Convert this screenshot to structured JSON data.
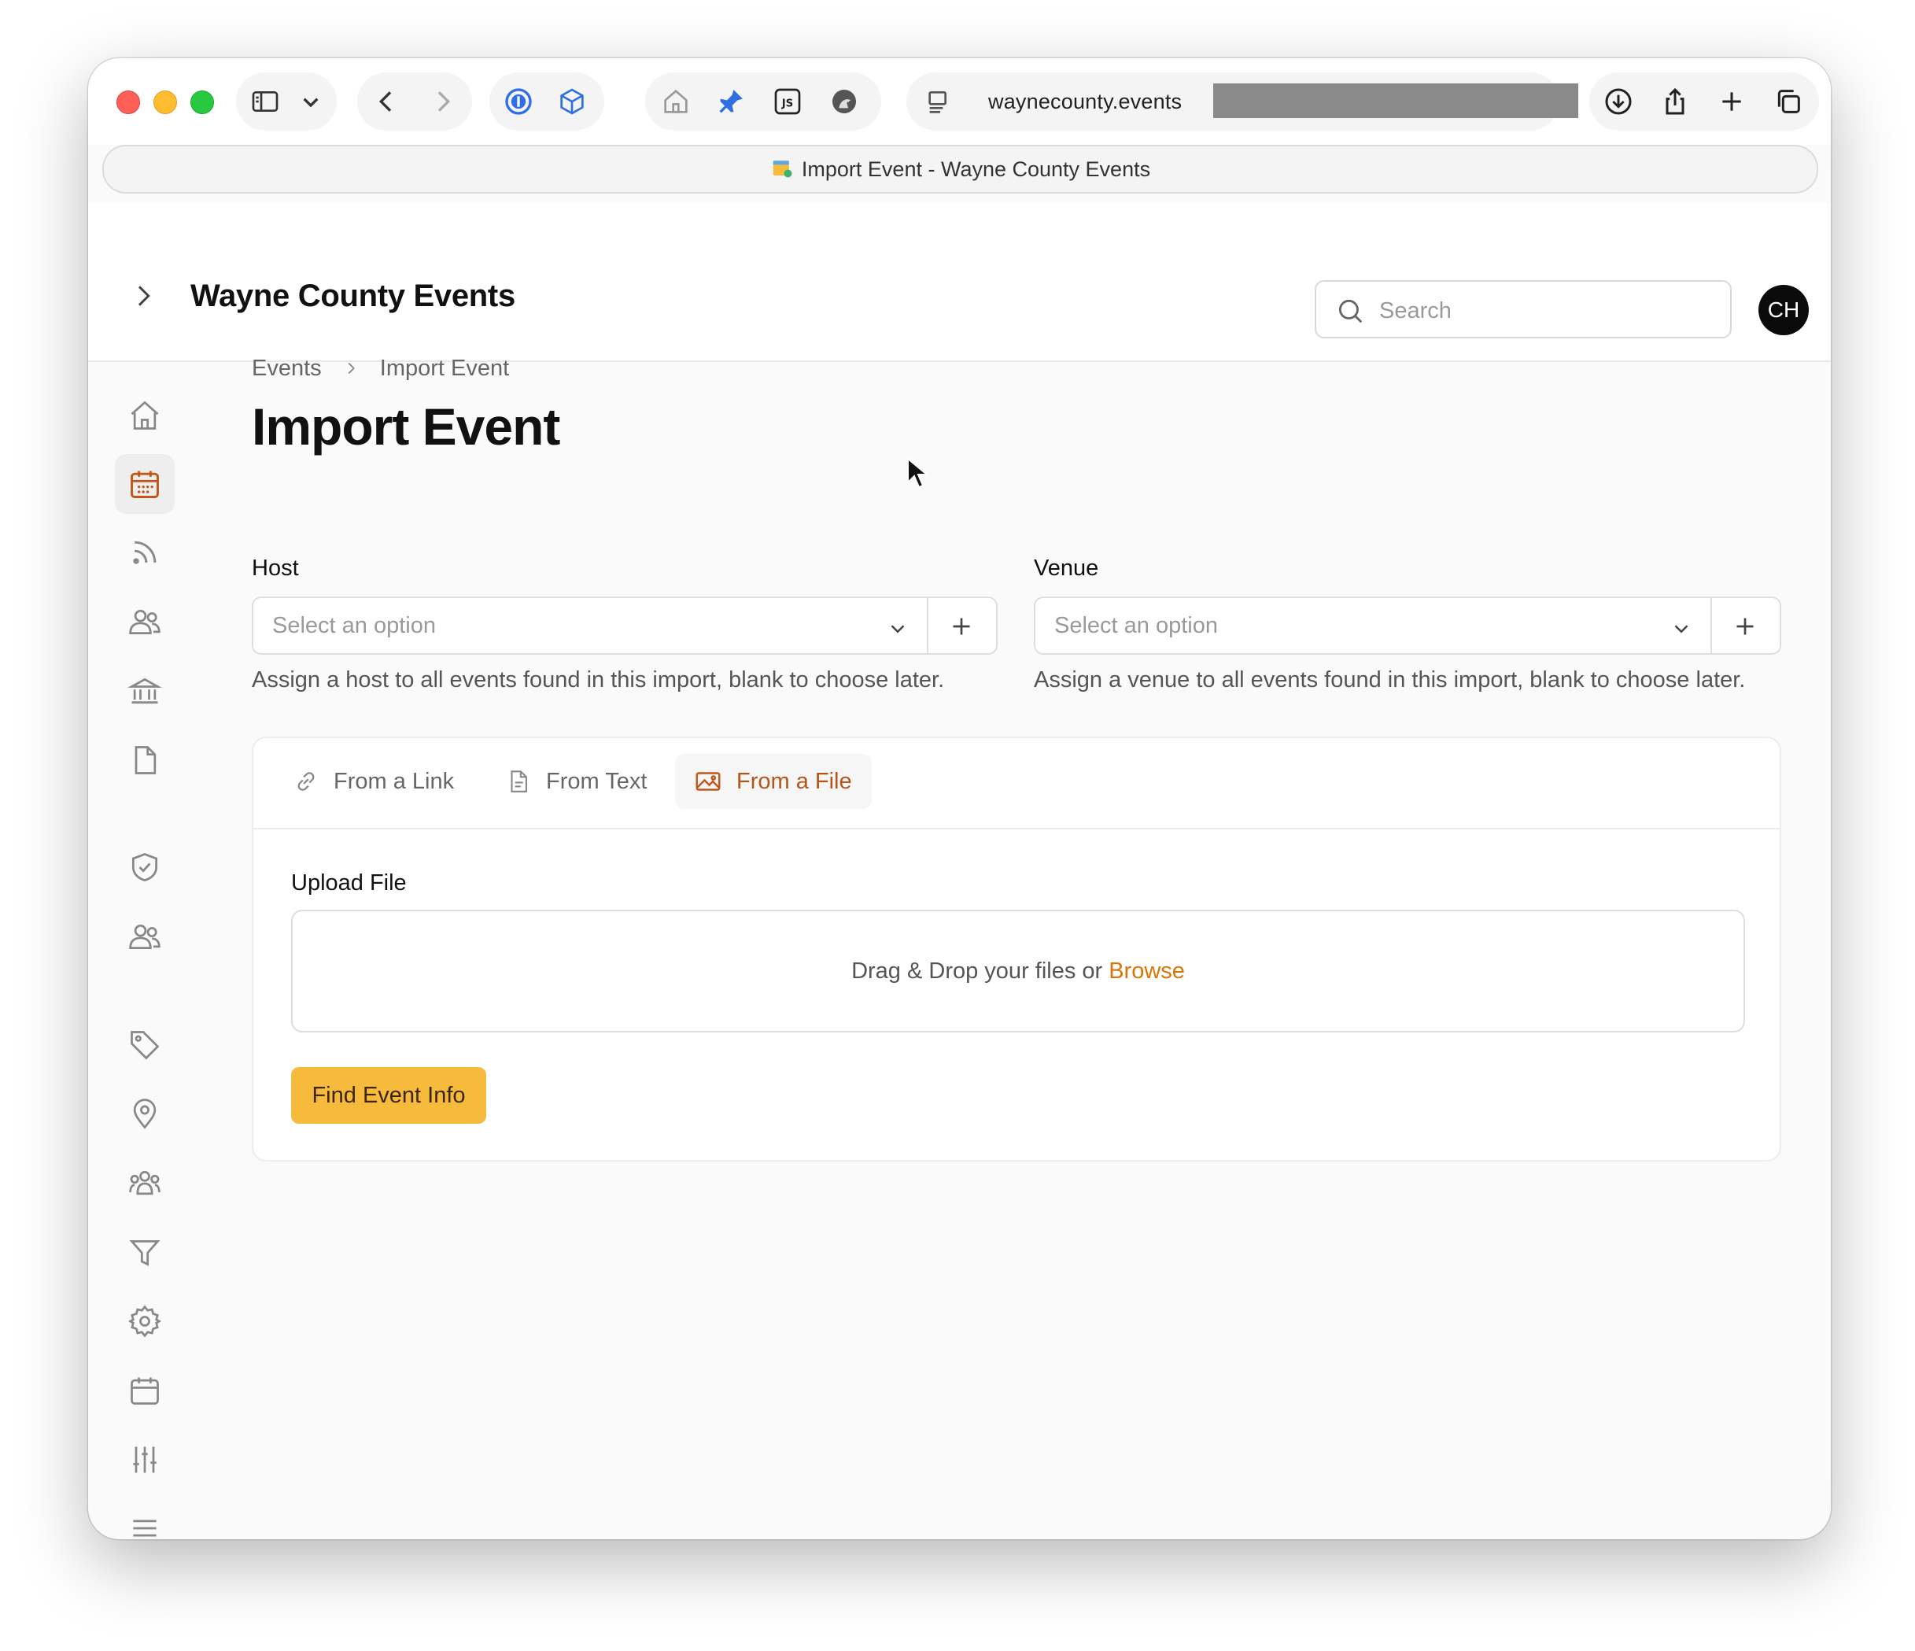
{
  "browser": {
    "url": "waynecounty.events",
    "tab_title": "Import Event - Wayne County Events"
  },
  "header": {
    "app_title": "Wayne County Events",
    "search_placeholder": "Search",
    "avatar_initials": "CH"
  },
  "sidebar": {
    "items": [
      {
        "icon": "home-icon"
      },
      {
        "icon": "calendar-icon",
        "active": true
      },
      {
        "icon": "rss-feed-icon"
      },
      {
        "icon": "users-icon"
      },
      {
        "icon": "venue-building-icon"
      },
      {
        "icon": "document-icon"
      },
      {
        "icon": "shield-check-icon"
      },
      {
        "icon": "team-users-icon"
      },
      {
        "icon": "tag-icon"
      },
      {
        "icon": "map-pin-icon"
      },
      {
        "icon": "group-icon"
      },
      {
        "icon": "filter-icon"
      },
      {
        "icon": "gear-icon"
      },
      {
        "icon": "calendar-blank-icon"
      },
      {
        "icon": "sliders-icon"
      },
      {
        "icon": "menu-icon"
      }
    ]
  },
  "breadcrumb": {
    "items": [
      "Events",
      "Import Event"
    ]
  },
  "page": {
    "title": "Import Event"
  },
  "form": {
    "host": {
      "label": "Host",
      "placeholder": "Select an option",
      "hint": "Assign a host to all events found in this import, blank to choose later."
    },
    "venue": {
      "label": "Venue",
      "placeholder": "Select an option",
      "hint": "Assign a venue to all events found in this import, blank to choose later."
    }
  },
  "import_tabs": {
    "tabs": [
      {
        "label": "From a Link",
        "icon": "link-icon"
      },
      {
        "label": "From Text",
        "icon": "document-text-icon"
      },
      {
        "label": "From a File",
        "icon": "image-icon",
        "active": true
      }
    ]
  },
  "upload": {
    "label": "Upload File",
    "drop_text": "Drag & Drop your files or",
    "browse_text": "Browse",
    "submit_label": "Find Event Info"
  },
  "colors": {
    "accent": "#f6ba3c",
    "active_tab": "#b4561a",
    "browse_link": "#d97706"
  }
}
